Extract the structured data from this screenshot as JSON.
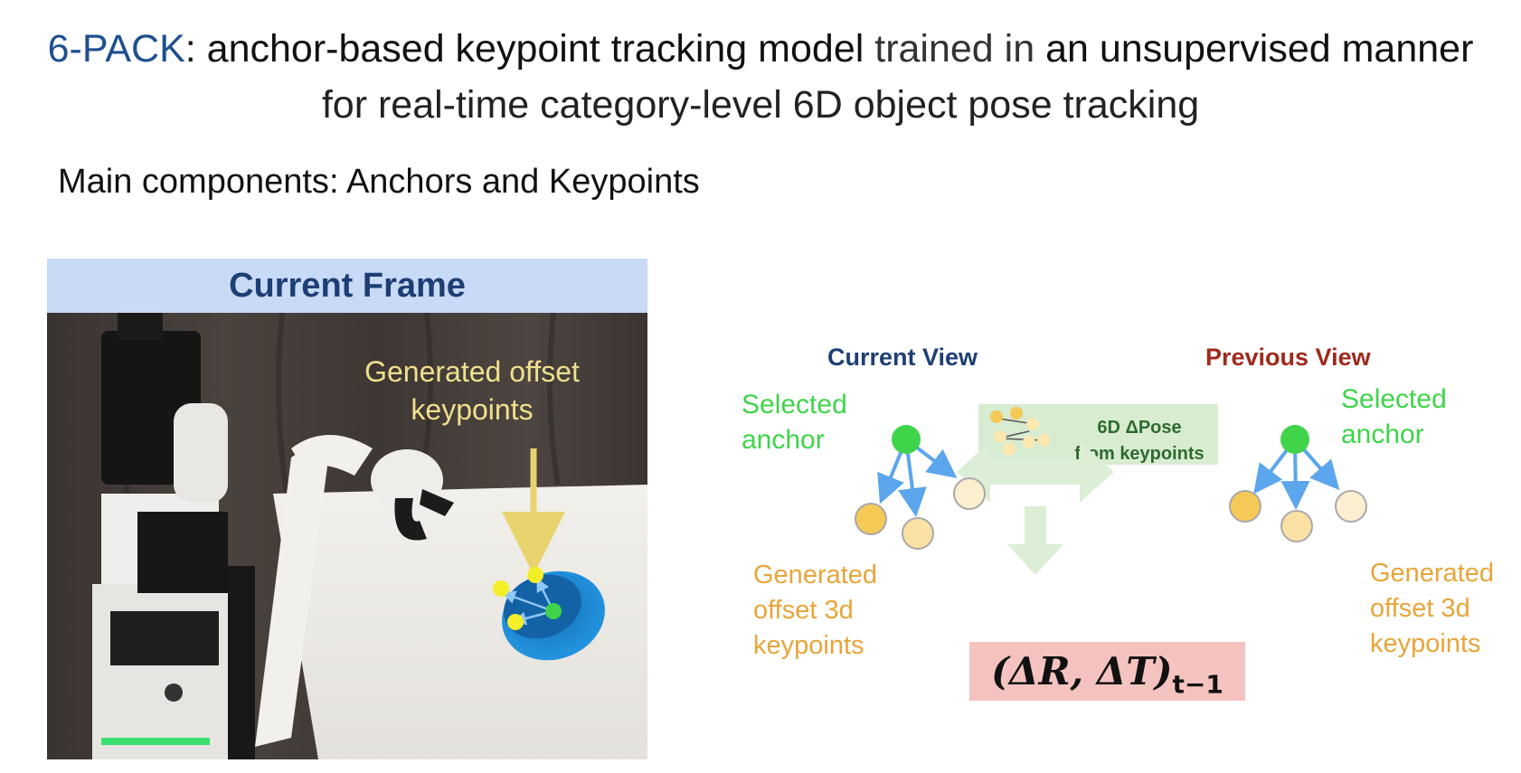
{
  "title": {
    "brand": "6-PACK",
    "colon": ": ",
    "emph1": "anchor-based keypoint tracking model",
    "plain1": " trained in ",
    "emph2": "an unsupervised manner",
    "line2": "for real-time category-level 6D object pose tracking"
  },
  "subheading": {
    "bold": "Main components",
    "rest": ": Anchors and Keypoints"
  },
  "frame_panel": {
    "header": "Current Frame",
    "annotation_line1": "Generated offset",
    "annotation_line2": "keypoints",
    "colors": {
      "annotation": "#efe08e",
      "arrow": "#e9d36e",
      "bowl": "#1f8ed8",
      "keypoint": "#f4ef28",
      "anchor": "#3fd44a"
    }
  },
  "diagram": {
    "current_view": "Current View",
    "previous_view": "Previous View",
    "selected_anchor_line1": "Selected",
    "selected_anchor_line2": "anchor",
    "generated_line1": "Generated",
    "generated_line2": "offset 3d",
    "generated_line3": "keypoints",
    "pose_line1": "6D ΔPose",
    "pose_line2": "from keypoints",
    "delta_main": "(ΔR, ΔT)",
    "delta_sub": "t−1",
    "colors": {
      "current_view": "#1e3f74",
      "previous_view": "#9e2a1c",
      "anchor": "#3fd44a",
      "arrow": "#5ba6ec",
      "keypoint_fill": "#f5c955",
      "keypoint_light": "#fbe7b0",
      "pose_box": "#d8ecd2",
      "delta_box": "#f4c3c0"
    }
  }
}
